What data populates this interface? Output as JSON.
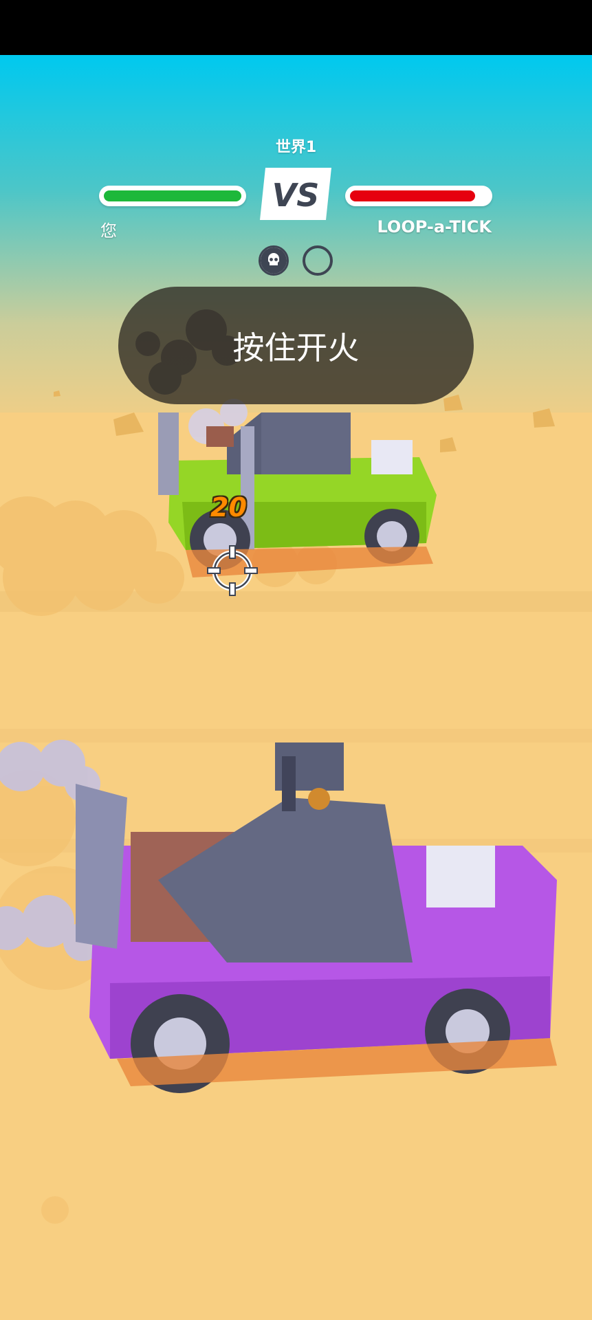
{
  "hud": {
    "world_label": "世界1",
    "vs_text": "VS",
    "player_name": "您",
    "opponent_name": "LOOP-a-TICK",
    "player_health": 1.0,
    "opponent_health": 0.91,
    "player_health_color": "#1db83a",
    "opponent_health_color": "#e6000f",
    "kills": [
      "skull-icon",
      "empty-circle-icon"
    ]
  },
  "hint": {
    "text": "按住开火"
  },
  "combat": {
    "damage_number": "20",
    "crosshair": "crosshair-icon"
  },
  "vehicles": {
    "enemy": {
      "body_color": "#95d626"
    },
    "player": {
      "body_color": "#b657e6"
    }
  },
  "colors": {
    "sky_top": "#00c9ef",
    "sand": "#f8cf82",
    "hint_bg": "#2d2922"
  }
}
